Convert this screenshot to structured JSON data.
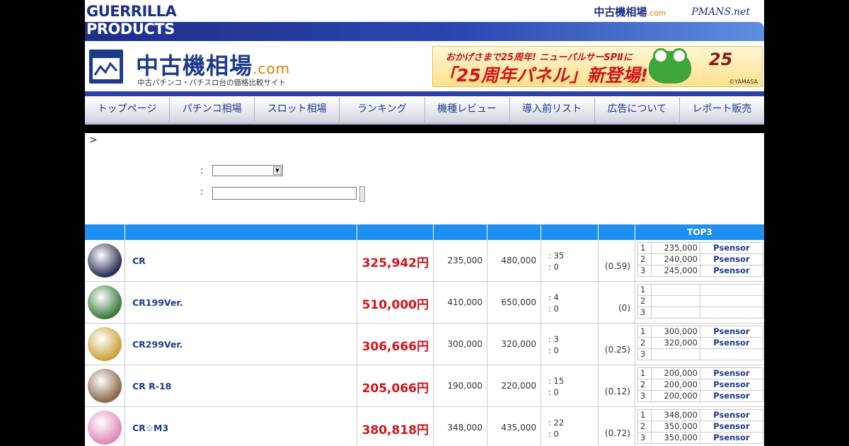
{
  "banner": {
    "brand_line1": "GUERRILLA",
    "brand_line2": "PRODUCTS",
    "site_link_main": "中古機相場",
    "site_link_suffix": ".com",
    "partner_link": "PMANS.net"
  },
  "header": {
    "logo_title": "中古機相場",
    "logo_suffix": ".com",
    "tagline": "中古パチンコ・パチスロ台の価格比較サイト",
    "ad": {
      "line1": "おかげさまで25周年! ニューパルサーSPⅡに",
      "line2": "「25周年パネル」新登場!",
      "badge": "25",
      "maker": "©YAMASA"
    }
  },
  "nav": [
    "トップページ",
    "パチンコ相場",
    "スロット相場",
    "ランキング",
    "機種レビュー",
    "導入前リスト",
    "広告について",
    "レポート販売"
  ],
  "search": {
    "breadcrumb": ">",
    "colon1": ":",
    "colon2": ":"
  },
  "table": {
    "top3_header": "TOP3",
    "rows": [
      {
        "name": "CR",
        "avg": "325,942円",
        "min": "235,000",
        "max": "480,000",
        "count_a": ": 35",
        "count_b": ": 0",
        "ratio": "(0.59)",
        "thumb_color": "#2a2f55",
        "top3": [
          [
            "1",
            "235,000",
            "Psensor"
          ],
          [
            "2",
            "240,000",
            "Psensor"
          ],
          [
            "3",
            "245,000",
            "Psensor"
          ]
        ]
      },
      {
        "name": "CR199Ver.",
        "avg": "510,000円",
        "min": "410,000",
        "max": "650,000",
        "count_a": ": 4",
        "count_b": ": 0",
        "ratio": "(0)",
        "thumb_color": "#3a7a3a",
        "top3": [
          [
            "1",
            "",
            ""
          ],
          [
            "2",
            "",
            ""
          ],
          [
            "3",
            "",
            ""
          ]
        ]
      },
      {
        "name": "CR299Ver.",
        "avg": "306,666円",
        "min": "300,000",
        "max": "320,000",
        "count_a": ": 3",
        "count_b": ": 0",
        "ratio": "(0.25)",
        "thumb_color": "#c9a23a",
        "top3": [
          [
            "1",
            "300,000",
            "Psensor"
          ],
          [
            "2",
            "320,000",
            "Psensor"
          ],
          [
            "3",
            "",
            ""
          ]
        ]
      },
      {
        "name": "CR R-18",
        "avg": "205,066円",
        "min": "190,000",
        "max": "220,000",
        "count_a": ": 15",
        "count_b": ": 0",
        "ratio": "(0.12)",
        "thumb_color": "#8a6a4a",
        "top3": [
          [
            "1",
            "200,000",
            "Psensor"
          ],
          [
            "2",
            "200,000",
            "Psensor"
          ],
          [
            "3",
            "200,000",
            "Psensor"
          ]
        ]
      },
      {
        "name": "CR☆M3",
        "avg": "380,818円",
        "min": "348,000",
        "max": "435,000",
        "count_a": ": 22",
        "count_b": ": 0",
        "ratio": "(0.72)",
        "thumb_color": "#e08ab8",
        "top3": [
          [
            "1",
            "348,000",
            "Psensor"
          ],
          [
            "2",
            "350,000",
            "Psensor"
          ],
          [
            "3",
            "350,000",
            "Psensor"
          ]
        ]
      }
    ]
  }
}
